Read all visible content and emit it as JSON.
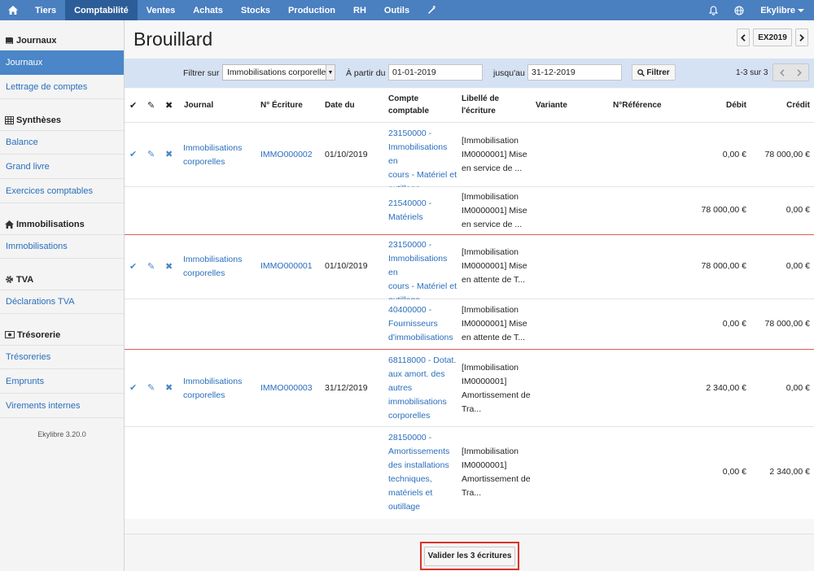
{
  "topnav": {
    "items": [
      {
        "label": "Tiers"
      },
      {
        "label": "Comptabilité"
      },
      {
        "label": "Ventes"
      },
      {
        "label": "Achats"
      },
      {
        "label": "Stocks"
      },
      {
        "label": "Production"
      },
      {
        "label": "RH"
      },
      {
        "label": "Outils"
      }
    ],
    "active": "Comptabilité",
    "user": "Ekylibre",
    "icons": [
      "home-icon",
      "wrench-icon",
      "bell-icon",
      "globe-icon",
      "caret-down-icon"
    ]
  },
  "sidebar": {
    "sections": [
      {
        "title": "Journaux",
        "icon": "book-icon",
        "items": [
          "Journaux",
          "Lettrage de comptes"
        ]
      },
      {
        "title": "Synthèses",
        "icon": "table-icon",
        "items": [
          "Balance",
          "Grand livre",
          "Exercices comptables"
        ]
      },
      {
        "title": "Immobilisations",
        "icon": "home-icon",
        "items": [
          "Immobilisations"
        ]
      },
      {
        "title": "TVA",
        "icon": "gear-icon",
        "items": [
          "Déclarations TVA"
        ]
      },
      {
        "title": "Trésorerie",
        "icon": "money-icon",
        "items": [
          "Trésoreries",
          "Emprunts",
          "Virements internes"
        ]
      }
    ],
    "active_item": "Journaux",
    "version": "Ekylibre 3.20.0"
  },
  "page": {
    "title": "Brouillard",
    "exercise": "EX2019",
    "accent_color": "#4a7fc0",
    "highlight_color": "#d9342b"
  },
  "filter": {
    "label_filter": "Filtrer sur",
    "selected": "Immobilisations corporelles",
    "label_from": "À partir du",
    "from": "01-01-2019",
    "label_to": "jusqu'au",
    "to": "31-12-2019",
    "button": "Filtrer",
    "count": "1-3 sur 3"
  },
  "table": {
    "headers": {
      "journal": "Journal",
      "numero": "N° Écriture",
      "date": "Date du",
      "compte_l1": "Compte",
      "compte_l2": "comptable",
      "libelle_l1": "Libellé de",
      "libelle_l2": "l'écriture",
      "variante": "Variante",
      "reference": "N°Référence",
      "debit": "Débit",
      "credit": "Crédit"
    },
    "entries": [
      {
        "journal_l1": "Immobilisations",
        "journal_l2": "corporelles",
        "numero": "IMMO000002",
        "date": "01/10/2019",
        "lines": [
          {
            "compte": [
              "23150000 -",
              "Immobilisations en",
              "cours - Matériel et",
              "outillage"
            ],
            "libelle": [
              "[Immobilisation",
              "IM0000001] Mise",
              "en service de ..."
            ],
            "debit": "0,00 €",
            "credit": "78 000,00 €"
          },
          {
            "compte": [
              "21540000 -",
              "Matériels"
            ],
            "libelle": [
              "[Immobilisation",
              "IM0000001] Mise",
              "en service de ..."
            ],
            "debit": "78 000,00 €",
            "credit": "0,00 €"
          }
        ]
      },
      {
        "journal_l1": "Immobilisations",
        "journal_l2": "corporelles",
        "numero": "IMMO000001",
        "date": "01/10/2019",
        "lines": [
          {
            "compte": [
              "23150000 -",
              "Immobilisations en",
              "cours - Matériel et",
              "outillage"
            ],
            "libelle": [
              "[Immobilisation",
              "IM0000001] Mise",
              "en attente de T..."
            ],
            "debit": "78 000,00 €",
            "credit": "0,00 €"
          },
          {
            "compte": [
              "40400000 -",
              "Fournisseurs",
              "d'immobilisations"
            ],
            "libelle": [
              "[Immobilisation",
              "IM0000001] Mise",
              "en attente de T..."
            ],
            "debit": "0,00 €",
            "credit": "78 000,00 €"
          }
        ]
      },
      {
        "journal_l1": "Immobilisations",
        "journal_l2": "corporelles",
        "numero": "IMMO000003",
        "date": "31/12/2019",
        "lines": [
          {
            "compte": [
              "68118000 - Dotat.",
              "aux amort. des",
              "autres",
              "immobilisations",
              "corporelles"
            ],
            "libelle": [
              "[Immobilisation",
              "IM0000001]",
              "Amortissement de",
              "Tra..."
            ],
            "debit": "2 340,00 €",
            "credit": "0,00 €"
          },
          {
            "compte": [
              "28150000 -",
              "Amortissements",
              "des installations",
              "techniques,",
              "matériels et",
              "outillage"
            ],
            "libelle": [
              "[Immobilisation",
              "IM0000001]",
              "Amortissement de",
              "Tra..."
            ],
            "debit": "0,00 €",
            "credit": "2 340,00 €"
          }
        ]
      }
    ]
  },
  "footer": {
    "validate_button": "Valider les 3 écritures"
  }
}
